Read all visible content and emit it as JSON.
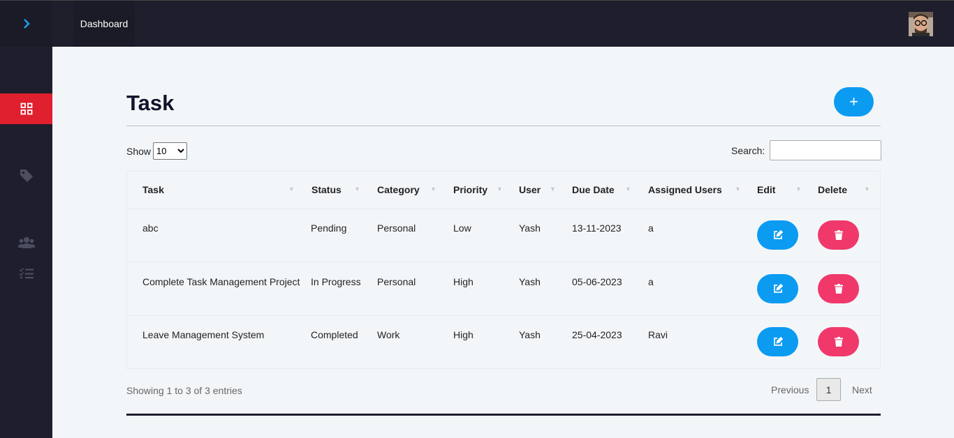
{
  "header": {
    "tab_label": "Dashboard"
  },
  "sidebar": {
    "items": [
      {
        "icon": "grid-icon",
        "active": true
      },
      {
        "icon": "tag-icon",
        "active": false
      },
      {
        "icon": "users-icon",
        "active": false
      },
      {
        "icon": "tasks-icon",
        "active": false
      }
    ]
  },
  "page": {
    "title": "Task",
    "add_label": "+"
  },
  "controls": {
    "show_label": "Show",
    "show_value": "10",
    "search_label": "Search:"
  },
  "table": {
    "columns": [
      "Task",
      "Status",
      "Category",
      "Priority",
      "User",
      "Due Date",
      "Assigned Users",
      "Edit",
      "Delete"
    ],
    "rows": [
      {
        "task": "abc",
        "status": "Pending",
        "category": "Personal",
        "priority": "Low",
        "user": "Yash",
        "due": "13-11-2023",
        "assigned": "a"
      },
      {
        "task": "Complete Task Management Project",
        "status": "In Progress",
        "category": "Personal",
        "priority": "High",
        "user": "Yash",
        "due": "05-06-2023",
        "assigned": "a"
      },
      {
        "task": "Leave Management System",
        "status": "Completed",
        "category": "Work",
        "priority": "High",
        "user": "Yash",
        "due": "25-04-2023",
        "assigned": "Ravi"
      }
    ]
  },
  "footer": {
    "info": "Showing 1 to 3 of 3 entries",
    "prev": "Previous",
    "page": "1",
    "next": "Next"
  },
  "colors": {
    "accent_blue": "#0b9bf1",
    "danger": "#f0386b",
    "active_nav": "#e0202e",
    "dark": "#1e1e2d"
  }
}
